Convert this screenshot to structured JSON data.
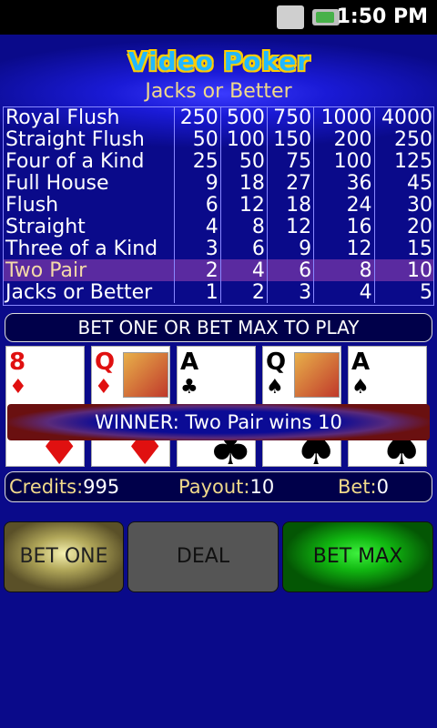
{
  "status": {
    "time": "1:50 PM",
    "airplane_icon": "airplane-icon",
    "battery_icon": "battery-charging-icon"
  },
  "header": {
    "logo_text": "Video Poker",
    "subtitle": "Jacks or Better"
  },
  "paytable": {
    "rows": [
      {
        "hand": "Royal Flush",
        "payouts": [
          "250",
          "500",
          "750",
          "1000",
          "4000"
        ]
      },
      {
        "hand": "Straight Flush",
        "payouts": [
          "50",
          "100",
          "150",
          "200",
          "250"
        ]
      },
      {
        "hand": "Four of a Kind",
        "payouts": [
          "25",
          "50",
          "75",
          "100",
          "125"
        ]
      },
      {
        "hand": "Full House",
        "payouts": [
          "9",
          "18",
          "27",
          "36",
          "45"
        ]
      },
      {
        "hand": "Flush",
        "payouts": [
          "6",
          "12",
          "18",
          "24",
          "30"
        ]
      },
      {
        "hand": "Straight",
        "payouts": [
          "4",
          "8",
          "12",
          "16",
          "20"
        ]
      },
      {
        "hand": "Three of a Kind",
        "payouts": [
          "3",
          "6",
          "9",
          "12",
          "15"
        ]
      },
      {
        "hand": "Two Pair",
        "payouts": [
          "2",
          "4",
          "6",
          "8",
          "10"
        ]
      },
      {
        "hand": "Jacks or Better",
        "payouts": [
          "1",
          "2",
          "3",
          "4",
          "5"
        ]
      }
    ],
    "highlighted_row": "Two Pair"
  },
  "message": "BET ONE OR BET MAX TO PLAY",
  "cards": [
    {
      "rank": "8",
      "suit": "♦",
      "color": "red",
      "face": false
    },
    {
      "rank": "Q",
      "suit": "♦",
      "color": "red",
      "face": true
    },
    {
      "rank": "A",
      "suit": "♣",
      "color": "black",
      "face": false
    },
    {
      "rank": "Q",
      "suit": "♠",
      "color": "black",
      "face": true
    },
    {
      "rank": "A",
      "suit": "♠",
      "color": "black",
      "face": false
    }
  ],
  "winner_text": "WINNER: Two Pair wins 10",
  "info": {
    "credits_label": "Credits:",
    "credits": "995",
    "payout_label": "Payout:",
    "payout": "10",
    "bet_label": "Bet:",
    "bet": "0"
  },
  "buttons": {
    "bet_one": "BET ONE",
    "deal": "DEAL",
    "bet_max": "BET MAX"
  },
  "colors": {
    "background": "#0a0a8a",
    "accent_gold": "#f0d98a",
    "highlight_row": "#5a2aa0",
    "bet_max_green": "#11b811",
    "bet_one_gold": "#b2a85a"
  }
}
